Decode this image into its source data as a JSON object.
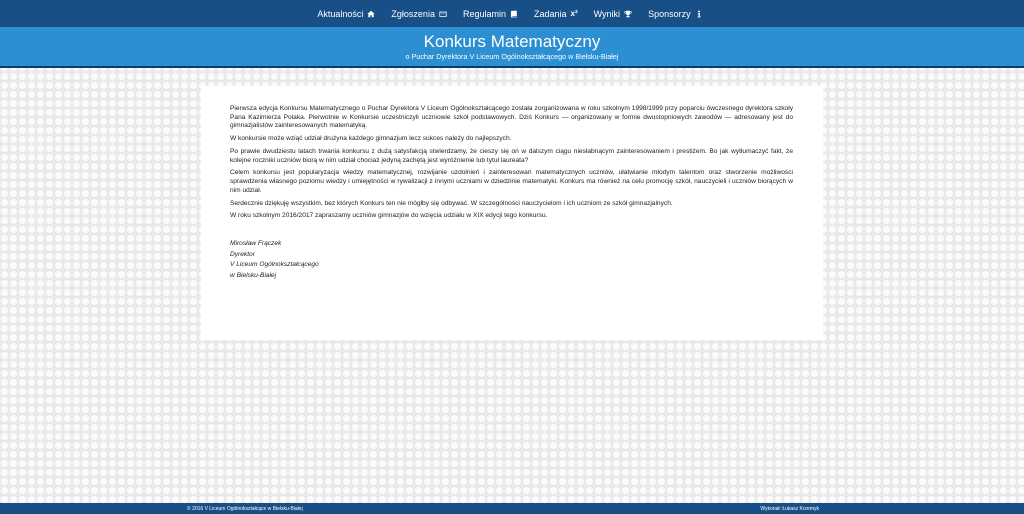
{
  "nav": {
    "items": [
      {
        "label": "Aktualności",
        "icon": "home-icon"
      },
      {
        "label": "Zgłoszenia",
        "icon": "envelope-icon"
      },
      {
        "label": "Regulamin",
        "icon": "book-icon"
      },
      {
        "label": "Zadania",
        "icon": "superscript-icon",
        "glyph": "x²"
      },
      {
        "label": "Wyniki",
        "icon": "trophy-icon"
      },
      {
        "label": "Sponsorzy",
        "icon": "info-icon"
      }
    ]
  },
  "banner": {
    "title": "Konkurs Matematyczny",
    "subtitle": "o Puchar Dyrektora V Liceum Ogólnokształcącego w Bielsku-Białej"
  },
  "article": {
    "paragraphs": [
      "Pierwsza edycja Konkursu Matematycznego o Puchar Dyrektora V Liceum Ogólnokształcącego została zorganizowana w roku szkolnym 1998/1999 przy poparciu ówczesnego dyrektora szkoły Pana Kazimierza Polaka. Pierwotnie w Konkursie uczestniczyli uczniowie szkół podstawowych. Dziś Konkurs — organizowany w formie dwustopniowych zawodów — adresowany jest do gimnazjalistów zainteresowanych matematyką.",
      "W konkursie może wziąć udział drużyna każdego gimnazjum lecz sukces należy do najlepszych.",
      "Po prawie dwudziestu latach trwania konkursu z dużą satysfakcją stwierdzamy, że cieszy się on w dalszym ciągu niesłabnącym zainteresowaniem i prestiżem. Bo jak wytłumaczyć fakt, że kolejne roczniki uczniów biorą w nim udział chociaż jedyną zachętą jest wyróżnienie lub tytuł laureata?",
      "Celem konkursu jest popularyzacja wiedzy matematycznej, rozwijanie uzdolnień i zainteresowań matematycznych uczniów, ułatwianie młodym talentom oraz stworzenie możliwości sprawdzenia własnego poziomu wiedzy i umiejętności w rywalizacji z innymi uczniami w dziedzinie matematyki. Konkurs ma również na celu promocję szkół, nauczycieli i uczniów biorących w nim udział.",
      "Serdecznie dziękuję wszystkim, bez których Konkurs ten nie mógłby się odbywać. W szczególności nauczycielom i ich uczniom ze szkół gimnazjalnych.",
      "W roku szkolnym 2016/2017 zapraszamy uczniów gimnazjów do wzięcia udziału w XIX edycji tego konkursu."
    ],
    "signature": [
      "Mirosław Frączek",
      "Dyrektor",
      "V Liceum Ogólnokształcącego",
      "w Bielsku-Białej"
    ]
  },
  "footer": {
    "left": "© 2016 V Liceum Ogólnokształcące w Bielsku-Białej",
    "right": "Wykonał: Łukasz Krzemyk"
  },
  "colors": {
    "navbar": "#174f86",
    "banner": "#2b8fd2",
    "footer": "#174f86"
  }
}
